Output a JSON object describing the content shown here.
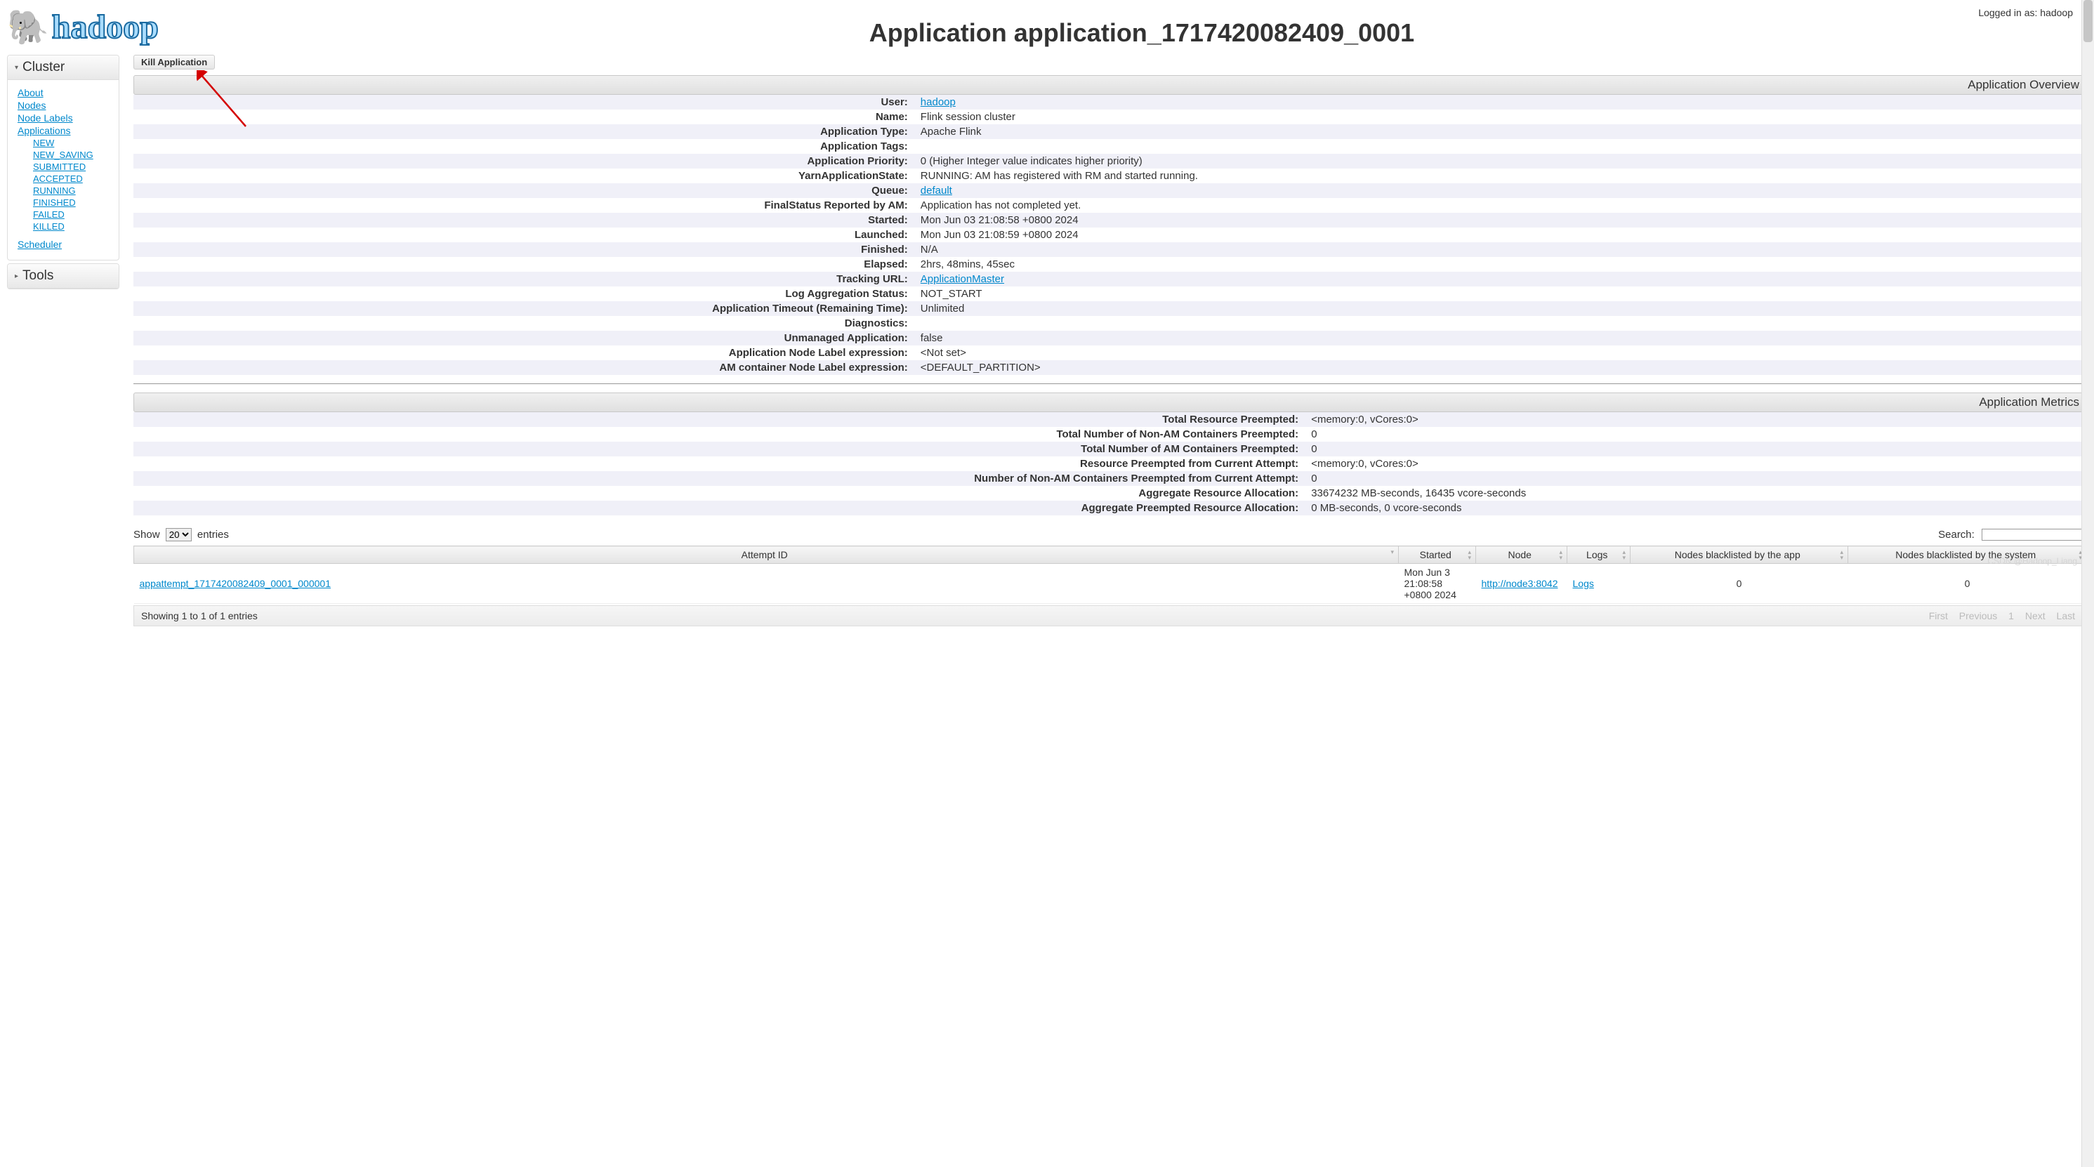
{
  "user_display": "Logged in as: hadoop",
  "logo_text": "hadoop",
  "page_title": "Application application_1717420082409_0001",
  "sidebar": {
    "cluster_header": "Cluster",
    "tools_header": "Tools",
    "links": {
      "about": "About",
      "nodes": "Nodes",
      "node_labels": "Node Labels",
      "applications": "Applications",
      "scheduler": "Scheduler"
    },
    "app_states": {
      "new": "NEW",
      "new_saving": "NEW_SAVING",
      "submitted": "SUBMITTED",
      "accepted": "ACCEPTED",
      "running": "RUNNING",
      "finished": "FINISHED",
      "failed": "FAILED",
      "killed": "KILLED"
    }
  },
  "kill_button": "Kill Application",
  "overview": {
    "title": "Application Overview",
    "rows": {
      "user_label": "User:",
      "user_value": "hadoop",
      "name_label": "Name:",
      "name_value": "Flink session cluster",
      "type_label": "Application Type:",
      "type_value": "Apache Flink",
      "tags_label": "Application Tags:",
      "tags_value": "",
      "priority_label": "Application Priority:",
      "priority_value": "0 (Higher Integer value indicates higher priority)",
      "state_label": "YarnApplicationState:",
      "state_value": "RUNNING: AM has registered with RM and started running.",
      "queue_label": "Queue:",
      "queue_value": "default",
      "final_label": "FinalStatus Reported by AM:",
      "final_value": "Application has not completed yet.",
      "started_label": "Started:",
      "started_value": "Mon Jun 03 21:08:58 +0800 2024",
      "launched_label": "Launched:",
      "launched_value": "Mon Jun 03 21:08:59 +0800 2024",
      "finished_label": "Finished:",
      "finished_value": "N/A",
      "elapsed_label": "Elapsed:",
      "elapsed_value": "2hrs, 48mins, 45sec",
      "tracking_label": "Tracking URL:",
      "tracking_value": "ApplicationMaster",
      "lagg_label": "Log Aggregation Status:",
      "lagg_value": "NOT_START",
      "timeout_label": "Application Timeout (Remaining Time):",
      "timeout_value": "Unlimited",
      "diag_label": "Diagnostics:",
      "diag_value": "",
      "unmanaged_label": "Unmanaged Application:",
      "unmanaged_value": "false",
      "nodelabel_label": "Application Node Label expression:",
      "nodelabel_value": "<Not set>",
      "amlabel_label": "AM container Node Label expression:",
      "amlabel_value": "<DEFAULT_PARTITION>"
    }
  },
  "metrics": {
    "title": "Application Metrics",
    "rows": {
      "trp_label": "Total Resource Preempted:",
      "trp_value": "<memory:0, vCores:0>",
      "tnam_label": "Total Number of Non-AM Containers Preempted:",
      "tnam_value": "0",
      "tam_label": "Total Number of AM Containers Preempted:",
      "tam_value": "0",
      "rpc_label": "Resource Preempted from Current Attempt:",
      "rpc_value": "<memory:0, vCores:0>",
      "nnam_label": "Number of Non-AM Containers Preempted from Current Attempt:",
      "nnam_value": "0",
      "agg_label": "Aggregate Resource Allocation:",
      "agg_value": "33674232 MB-seconds, 16435 vcore-seconds",
      "aggp_label": "Aggregate Preempted Resource Allocation:",
      "aggp_value": "0 MB-seconds, 0 vcore-seconds"
    }
  },
  "datatable": {
    "show_label": "Show",
    "entries_label": "entries",
    "show_value": "20",
    "search_label": "Search:",
    "headers": {
      "attempt": "Attempt ID",
      "started": "Started",
      "node": "Node",
      "logs": "Logs",
      "bl_app": "Nodes blacklisted by the app",
      "bl_sys": "Nodes blacklisted by the system"
    },
    "row": {
      "attempt": "appattempt_1717420082409_0001_000001",
      "started": "Mon Jun 3 21:08:58 +0800 2024",
      "node": "http://node3:8042",
      "logs": "Logs",
      "bl_app": "0",
      "bl_sys": "0"
    },
    "footer_info": "Showing 1 to 1 of 1 entries",
    "paginate": {
      "first": "First",
      "prev": "Previous",
      "p1": "1",
      "next": "Next",
      "last": "Last"
    }
  },
  "watermark": "CSDN @Hadoop_Liang"
}
